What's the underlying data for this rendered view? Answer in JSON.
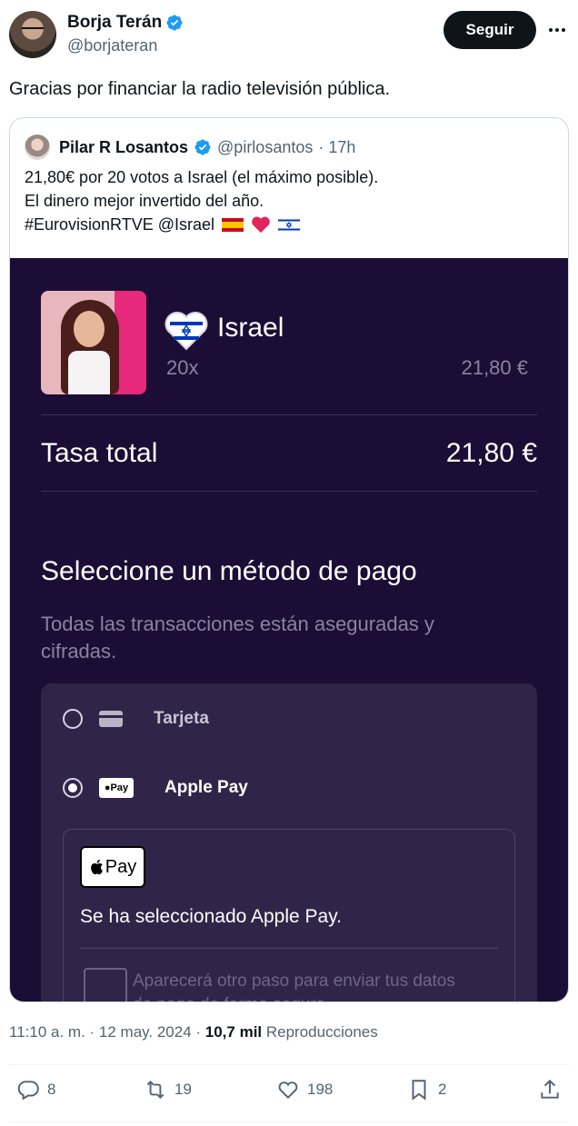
{
  "author": {
    "name": "Borja Terán",
    "handle": "@borjateran",
    "follow_label": "Seguir"
  },
  "tweet": {
    "text": "Gracias por financiar la radio televisión pública."
  },
  "quote": {
    "name": "Pilar R Losantos",
    "handle": "@pirlosantos",
    "time": "· 17h",
    "lines": [
      "21,80€ por 20 votos a Israel (el máximo posible).",
      "El dinero mejor invertido del año.",
      "#EurovisionRTVE @Israel"
    ],
    "emoji": [
      "spain-flag",
      "red-heart",
      "israel-flag"
    ]
  },
  "payment": {
    "country": "Israel",
    "count": "20x",
    "price": "21,80 €",
    "total_label": "Tasa total",
    "total_value": "21,80 €",
    "title": "Seleccione un método de pago",
    "subtitle": "Todas las transacciones están aseguradas y cifradas.",
    "options": [
      {
        "label": "Tarjeta",
        "icon": "card-icon",
        "selected": false
      },
      {
        "label": "Apple Pay",
        "icon": "applepay-icon",
        "selected": true
      }
    ],
    "applepay_badge": "Pay",
    "selected_text": "Se ha seleccionado Apple Pay.",
    "next_step": "Aparecerá otro paso para enviar tus datos de pago de forma segura."
  },
  "meta": {
    "time": "11:10 a. m. · 12 may. 2024 · ",
    "views": "10,7 mil",
    "views_label": "Reproducciones"
  },
  "actions": {
    "replies": "8",
    "reposts": "19",
    "likes": "198",
    "bookmarks": "2"
  },
  "colors": {
    "verified": "#1d9bf0",
    "panel_bg": "#1c0d36",
    "text_secondary": "#536471"
  }
}
